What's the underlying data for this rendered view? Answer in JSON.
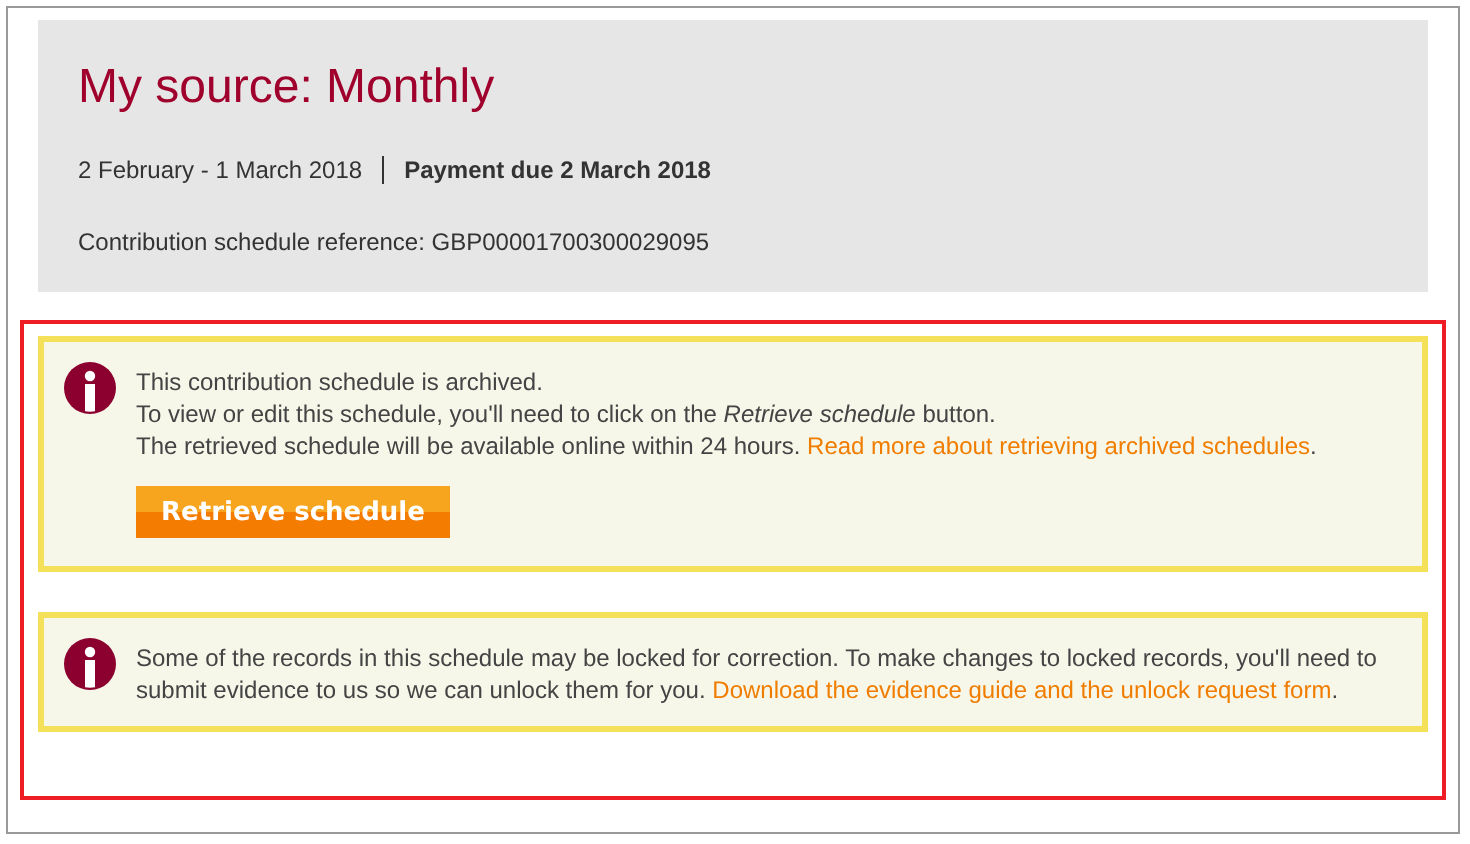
{
  "header": {
    "title": "My source: Monthly",
    "period": "2 February - 1 March 2018",
    "payment_due": "Payment due 2 March 2018",
    "reference": "Contribution schedule reference: GBP00001700300029095"
  },
  "alerts": [
    {
      "kind": "info",
      "lines": [
        {
          "text": "This contribution schedule is archived."
        },
        {
          "text": "To view or edit this schedule, you'll need to click on the *Retrieve schedule* button."
        },
        {
          "text": "The retrieved schedule will be available online within 24 hours. ",
          "link": "Read more about retrieving archived schedules",
          "after": "."
        }
      ],
      "button": "Retrieve schedule"
    },
    {
      "kind": "info",
      "lines": [
        {
          "text": "Some of the records in this schedule may be locked for correction. To make changes to locked records, you'll need to submit evidence to us so we can unlock them for you. ",
          "link": "Download the evidence guide and the unlock request form",
          "after": "."
        }
      ]
    }
  ]
}
